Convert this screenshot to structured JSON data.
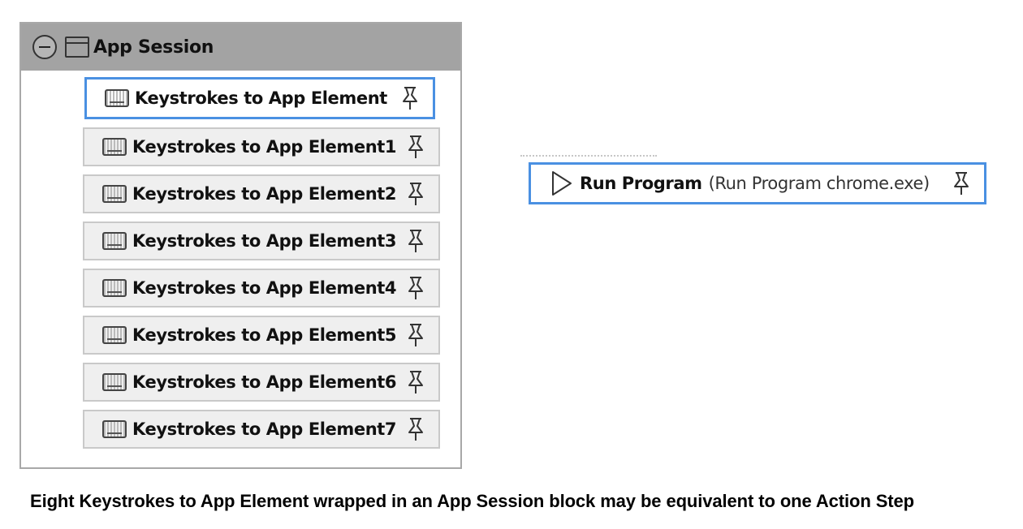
{
  "session": {
    "title": "App Session",
    "collapse_icon": "collapse-minus-icon",
    "window_icon": "window-icon",
    "steps": [
      {
        "label": "Keystrokes to App Element",
        "icon": "keyboard-icon",
        "selected": true
      },
      {
        "label": "Keystrokes to App Element1",
        "icon": "keyboard-icon",
        "selected": false
      },
      {
        "label": "Keystrokes to App Element2",
        "icon": "keyboard-icon",
        "selected": false
      },
      {
        "label": "Keystrokes to App Element3",
        "icon": "keyboard-icon",
        "selected": false
      },
      {
        "label": "Keystrokes to App Element4",
        "icon": "keyboard-icon",
        "selected": false
      },
      {
        "label": "Keystrokes to App Element5",
        "icon": "keyboard-icon",
        "selected": false
      },
      {
        "label": "Keystrokes to App Element6",
        "icon": "keyboard-icon",
        "selected": false
      },
      {
        "label": "Keystrokes to App Element7",
        "icon": "keyboard-icon",
        "selected": false
      }
    ]
  },
  "run_program": {
    "label": "Run Program",
    "detail": "(Run Program chrome.exe)",
    "icon": "play-icon"
  },
  "caption": "Eight Keystrokes to App Element wrapped in an App Session block may be equivalent to one Action Step",
  "colors": {
    "selection_border": "#4a90e2",
    "header_background": "#a3a3a3",
    "step_background": "#efefef"
  }
}
